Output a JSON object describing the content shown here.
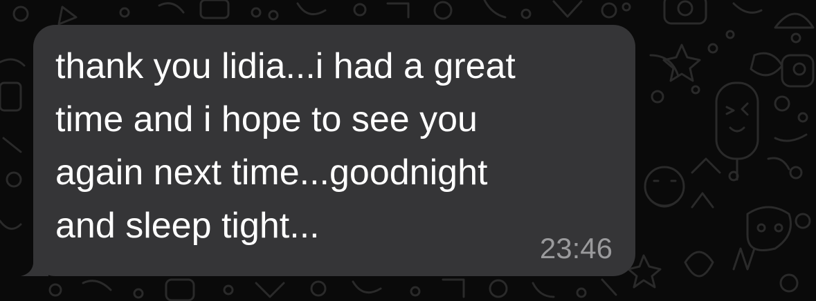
{
  "conversation": {
    "message": {
      "text": "thank you lidia...i had a great\ntime and i hope to see you\nagain next time...goodnight\nand sleep tight...",
      "time": "23:46",
      "direction": "incoming"
    }
  },
  "theme": {
    "background": "#0a0a0a",
    "bubble": "#353537",
    "text": "#ffffff",
    "timestamp": "#9a9a9c"
  },
  "background_icons": [
    "doodle-pattern-icon"
  ]
}
